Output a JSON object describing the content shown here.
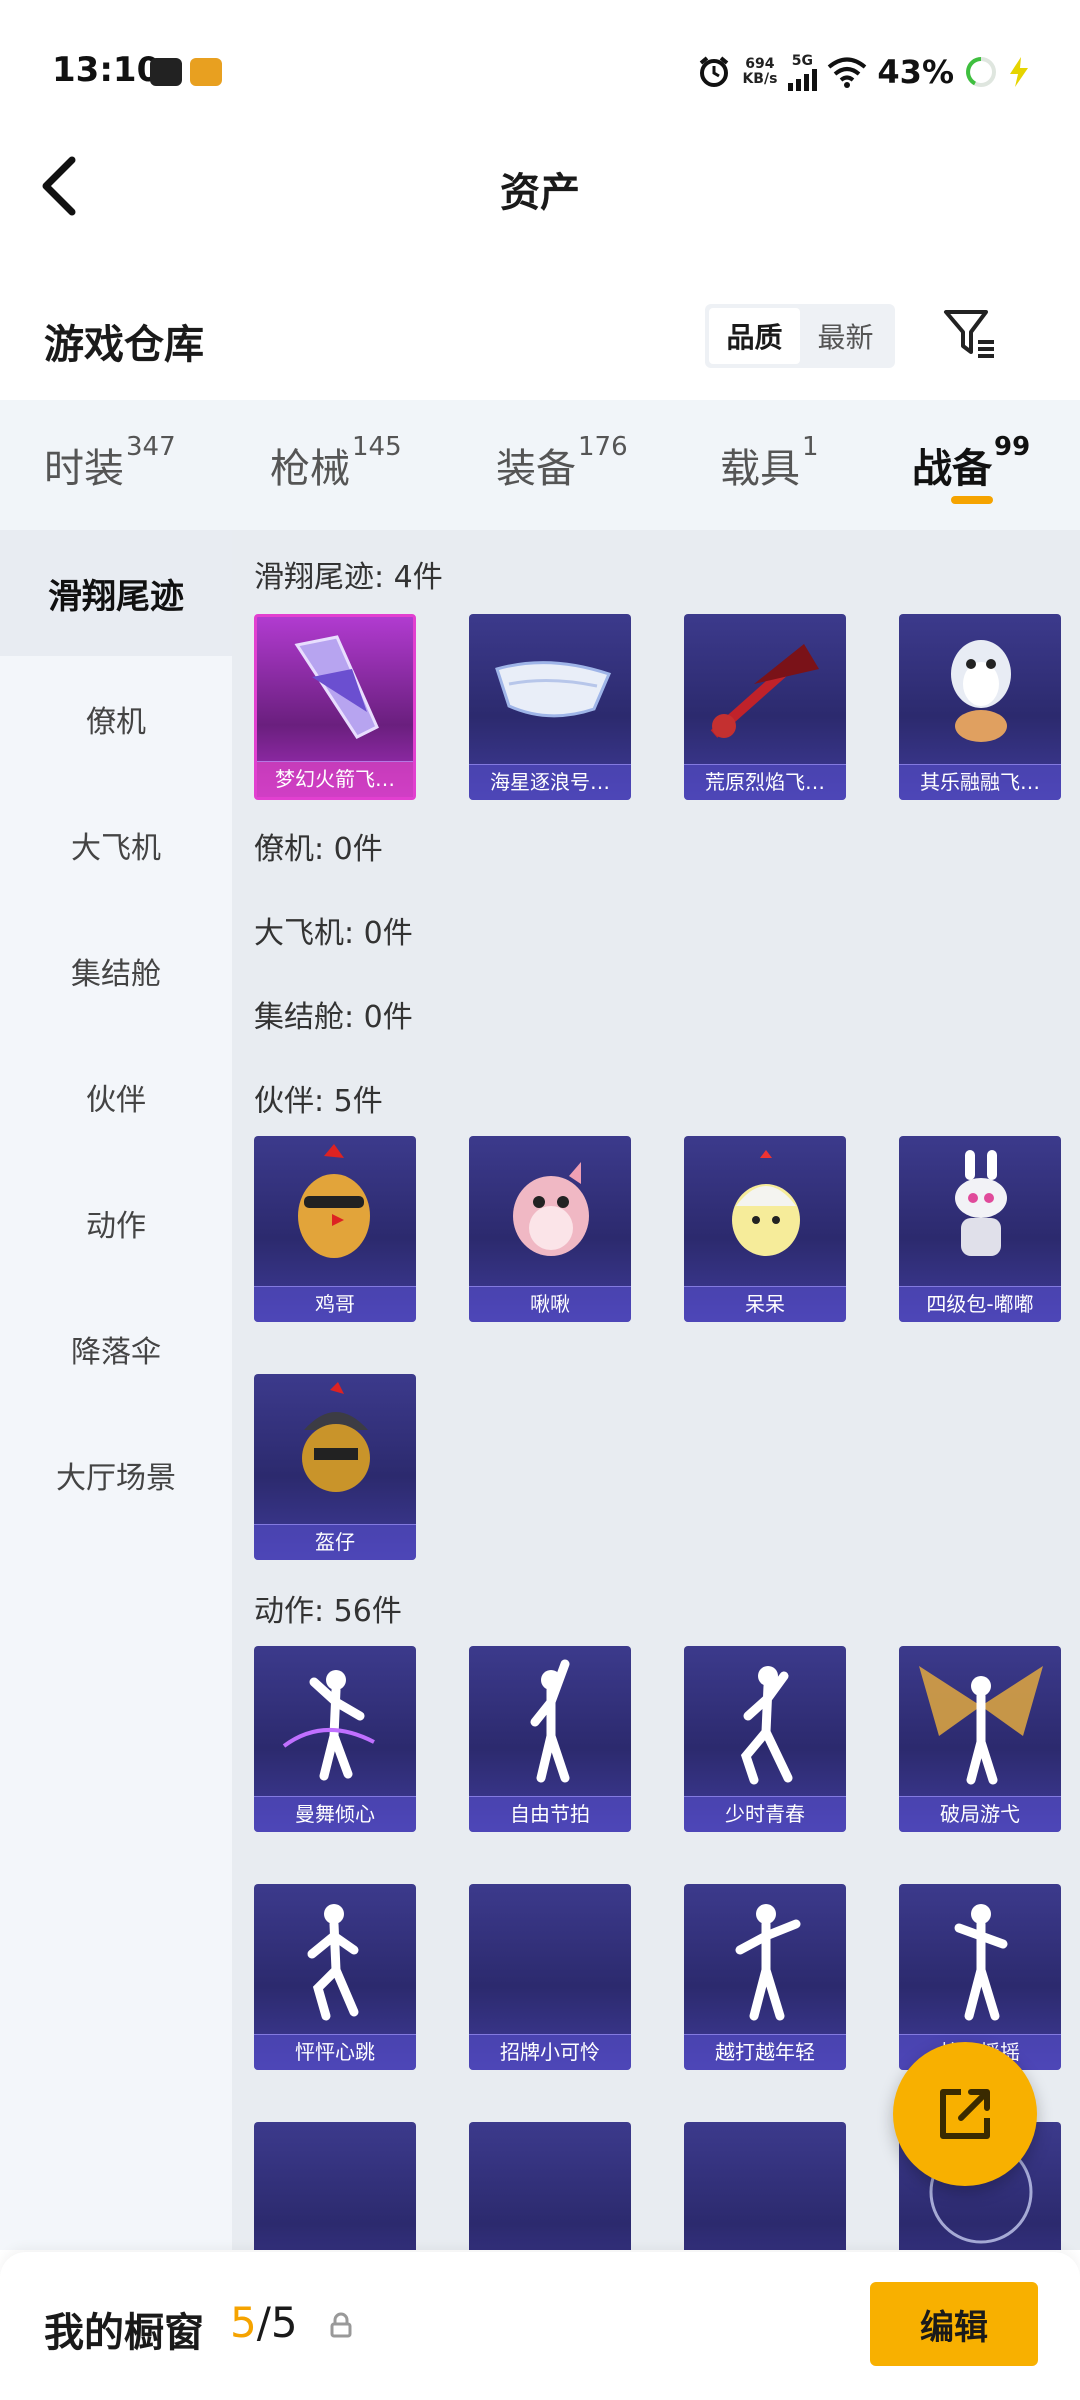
{
  "status_bar": {
    "time": "13:10",
    "speed_value": "694",
    "speed_unit": "KB/s",
    "network": "5G",
    "battery": "43%"
  },
  "header": {
    "title": "资产"
  },
  "warehouse": {
    "title": "游戏仓库",
    "sort_options": [
      "品质",
      "最新"
    ],
    "sort_selected": "品质"
  },
  "tabs": [
    {
      "label": "时装",
      "count": "347"
    },
    {
      "label": "枪械",
      "count": "145"
    },
    {
      "label": "装备",
      "count": "176"
    },
    {
      "label": "载具",
      "count": "1"
    },
    {
      "label": "战备",
      "count": "99"
    }
  ],
  "active_tab": "战备",
  "sidebar": {
    "items": [
      "滑翔尾迹",
      "僚机",
      "大飞机",
      "集结舱",
      "伙伴",
      "动作",
      "降落伞",
      "大厅场景"
    ],
    "active": "滑翔尾迹"
  },
  "sections": [
    {
      "title": "滑翔尾迹: 4件",
      "items": [
        "梦幻火箭飞…",
        "海星逐浪号…",
        "荒原烈焰飞…",
        "其乐融融飞…"
      ]
    },
    {
      "title": "僚机: 0件",
      "items": []
    },
    {
      "title": "大飞机: 0件",
      "items": []
    },
    {
      "title": "集结舱: 0件",
      "items": []
    },
    {
      "title": "伙伴: 5件",
      "items": [
        "鸡哥",
        "啾啾",
        "呆呆",
        "四级包-嘟嘟",
        "盔仔"
      ]
    },
    {
      "title": "动作: 56件",
      "items": [
        "曼舞倾心",
        "自由节拍",
        "少时青春",
        "破局游弋",
        "怦怦心跳",
        "招牌小可怜",
        "越打越年轻",
        "拉伍摇摇",
        "",
        "",
        "",
        ""
      ]
    }
  ],
  "bottom_bar": {
    "title": "我的橱窗",
    "used": "5",
    "separator": "/",
    "total": "5",
    "edit_label": "编辑"
  },
  "icons": {
    "back": "chevron-left-icon",
    "filter": "filter-icon",
    "share": "share-external-icon",
    "lock": "lock-icon"
  },
  "colors": {
    "accent": "#f8b000",
    "card_bg": "#2c2a6e",
    "card_highlight": "#e240d0"
  }
}
